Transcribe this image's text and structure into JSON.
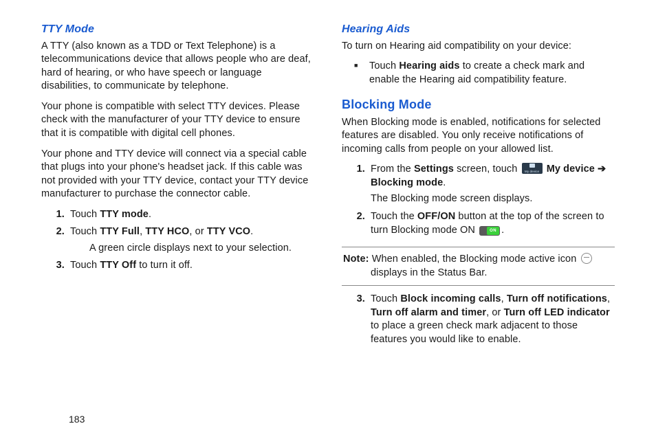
{
  "pageNumber": "183",
  "left": {
    "tty": {
      "heading": "TTY Mode",
      "p1": "A TTY (also known as a TDD or Text Telephone) is a telecommunications device that allows people who are deaf, hard of hearing, or who have speech or language disabilities, to communicate by telephone.",
      "p2": "Your phone is compatible with select TTY devices. Please check with the manufacturer of your TTY device to ensure that it is compatible with digital cell phones.",
      "p3": "Your phone and TTY device will connect via a special cable that plugs into your phone's headset jack. If this cable was not provided with your TTY device, contact your TTY device manufacturer to purchase the connector cable.",
      "s1_a": "Touch ",
      "s1_b": "TTY mode",
      "s1_c": ".",
      "s2_a": "Touch ",
      "s2_b": "TTY Full",
      "s2_c": ", ",
      "s2_d": "TTY HCO",
      "s2_e": ", or ",
      "s2_f": "TTY VCO",
      "s2_g": ".",
      "s2_sub": "A green circle displays next to your selection.",
      "s3_a": "Touch ",
      "s3_b": "TTY Off",
      "s3_c": " to turn it off."
    }
  },
  "right": {
    "hearing": {
      "heading": "Hearing Aids",
      "p1": "To turn on Hearing aid compatibility on your device:",
      "b1_a": "Touch ",
      "b1_b": "Hearing aids",
      "b1_c": " to create a check mark and enable the Hearing aid compatibility feature."
    },
    "blocking": {
      "heading": "Blocking Mode",
      "p1": "When Blocking mode is enabled, notifications for selected features are disabled. You only receive notifications of incoming calls from people on your allowed list.",
      "s1_a": "From the ",
      "s1_b": "Settings",
      "s1_c": " screen, touch ",
      "s1_d": "My device",
      "s1_arrow": " ➔ ",
      "s1_e": "Blocking mode",
      "s1_f": ".",
      "s1_sub": "The Blocking mode screen displays.",
      "s2_a": "Touch the ",
      "s2_b": "OFF/ON",
      "s2_c": " button at the top of the screen to turn Blocking mode ON ",
      "s2_d": ".",
      "note_label": "Note:",
      "note_a": " When enabled, the Blocking mode active icon ",
      "note_b": " displays in the Status Bar.",
      "s3_a": "Touch ",
      "s3_b": "Block incoming calls",
      "s3_c": ", ",
      "s3_d": "Turn off notifications",
      "s3_e": ", ",
      "s3_f": "Turn off alarm and timer",
      "s3_g": ", or ",
      "s3_h": "Turn off LED indicator",
      "s3_i": " to place a green check mark adjacent to those features you would like to enable."
    }
  }
}
